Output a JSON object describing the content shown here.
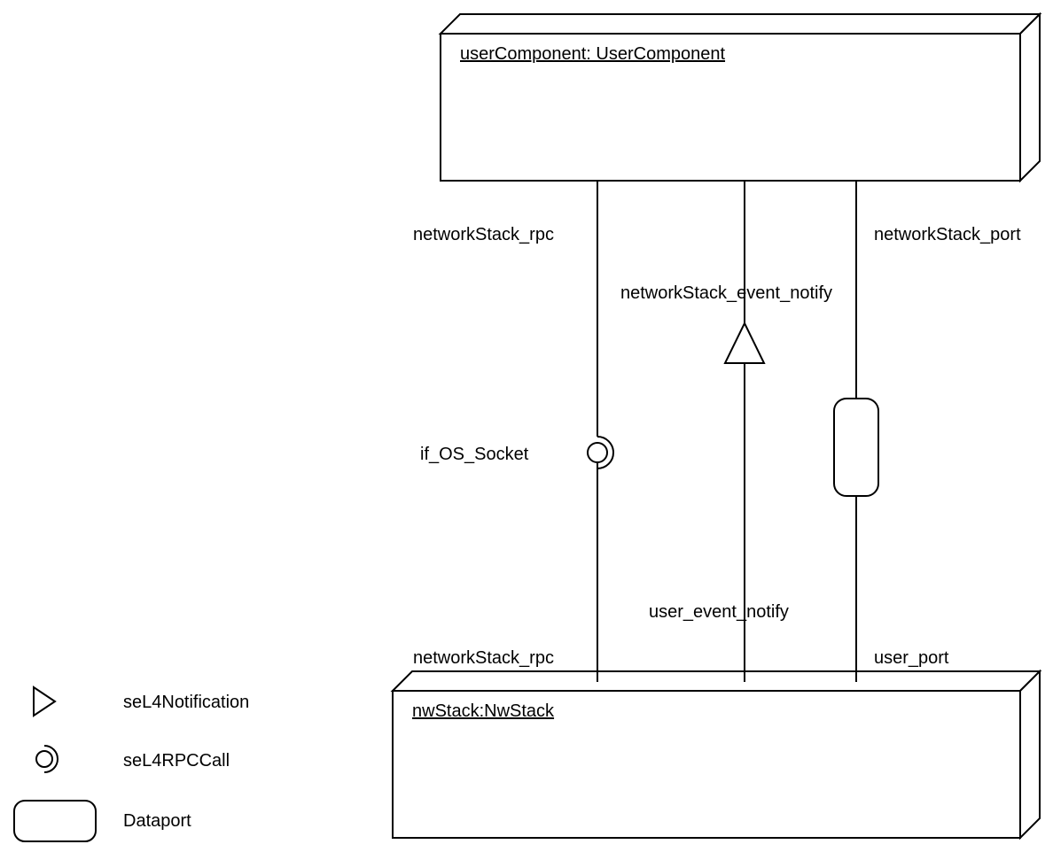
{
  "components": {
    "userComponent": {
      "label": "userComponent: UserComponent"
    },
    "nwStack": {
      "label": "nwStack:NwStack"
    }
  },
  "connections": {
    "topLeft": "networkStack_rpc",
    "topMiddle": "networkStack_event_notify",
    "topRight": "networkStack_port",
    "interface": "if_OS_Socket",
    "bottomLeft": "networkStack_rpc",
    "bottomMiddle": "user_event_notify",
    "bottomRight": "user_port"
  },
  "legend": {
    "notification": "seL4Notification",
    "rpcCall": "seL4RPCCall",
    "dataport": "Dataport"
  }
}
